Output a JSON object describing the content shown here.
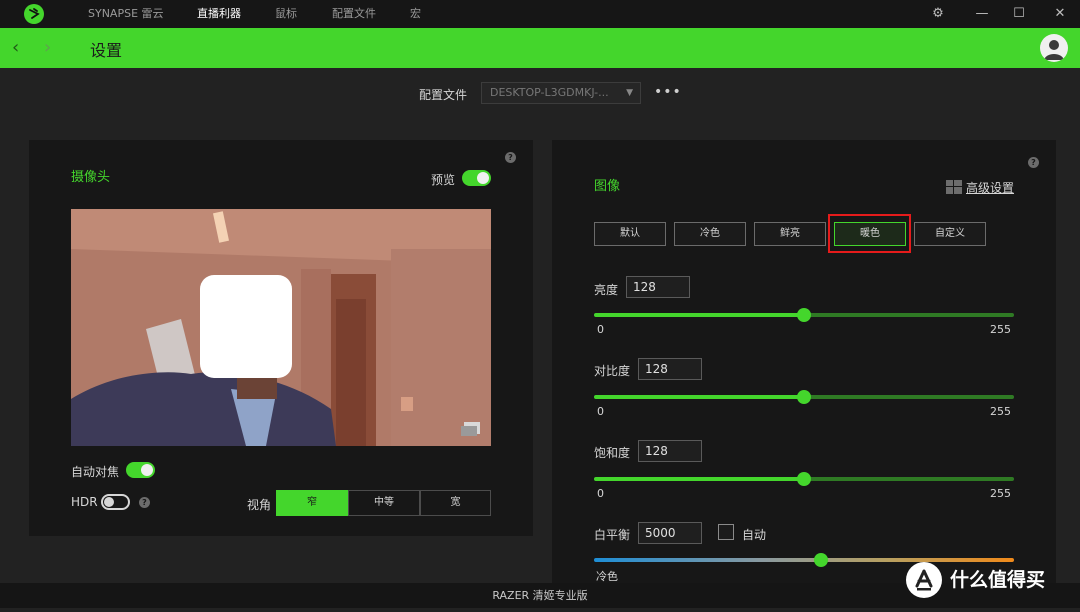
{
  "topbar": {
    "nav": [
      "SYNAPSE 雷云",
      "直播利器",
      "鼠标",
      "配置文件",
      "宏"
    ],
    "active_index": 1,
    "window_controls": {
      "settings": "⚙",
      "minimize": "—",
      "maximize": "☐",
      "close": "✕"
    }
  },
  "header": {
    "back": "‹",
    "forward": "›",
    "title": "设置"
  },
  "profile": {
    "label": "配置文件",
    "selected": "DESKTOP-L3GDMKJ-...",
    "more": "•••"
  },
  "camera_panel": {
    "title": "摄像头",
    "preview_label": "预览",
    "preview_on": true,
    "autofocus_label": "自动对焦",
    "autofocus_on": true,
    "hdr_label": "HDR",
    "hdr_on": false,
    "fov_label": "视角",
    "fov_options": [
      "窄",
      "中等",
      "宽"
    ],
    "fov_selected": 0
  },
  "image_panel": {
    "title": "图像",
    "advanced_label": "高级设置",
    "presets": [
      "默认",
      "冷色",
      "鲜亮",
      "暖色",
      "自定义"
    ],
    "preset_selected": 3,
    "brightness": {
      "label": "亮度",
      "value": "128",
      "min": "0",
      "max": "255",
      "level": 0.5
    },
    "contrast": {
      "label": "对比度",
      "value": "128",
      "min": "0",
      "max": "255",
      "level": 0.5
    },
    "saturation": {
      "label": "饱和度",
      "value": "128",
      "min": "0",
      "max": "255",
      "level": 0.5
    },
    "white_balance": {
      "label": "白平衡",
      "value": "5000",
      "auto_label": "自动",
      "auto_checked": false,
      "min_label": "冷色",
      "level": 0.54
    }
  },
  "footer": {
    "text": "RAZER 清姬专业版"
  },
  "watermark": {
    "text": "什么值得买",
    "icon_glyph": "值"
  },
  "colors": {
    "accent": "#44d62c",
    "highlight": "#e51b1b"
  }
}
